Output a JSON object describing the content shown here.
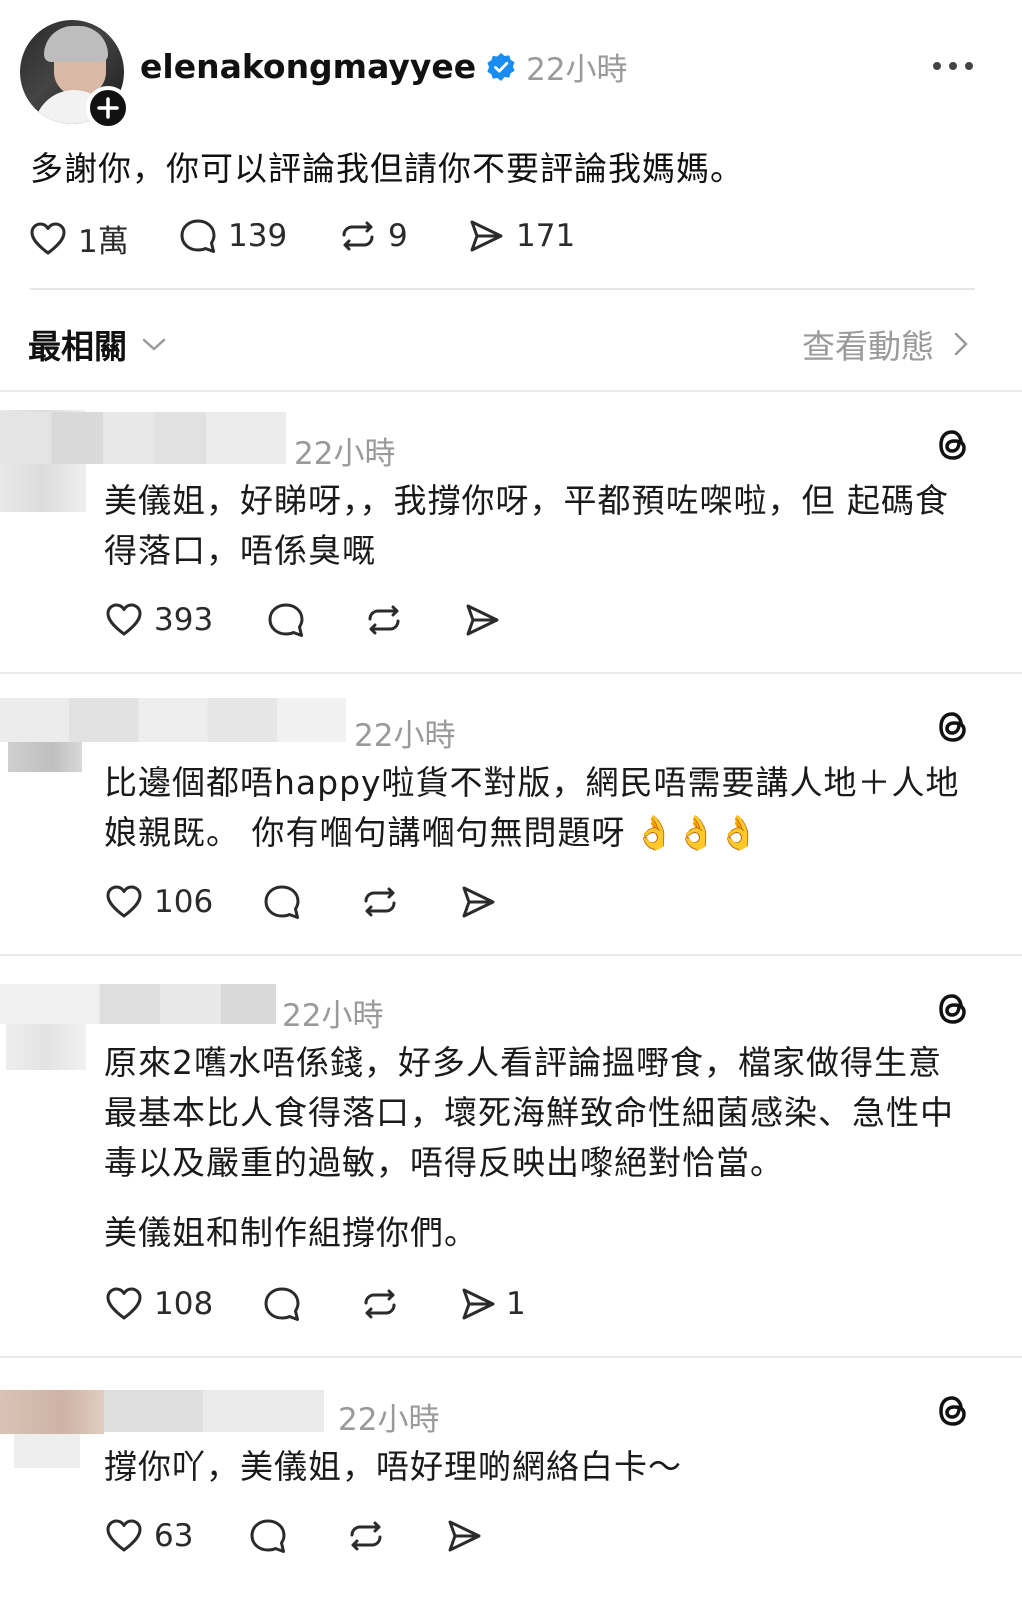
{
  "post": {
    "username": "elenakongmayyee",
    "time": "22小時",
    "text": "多謝你，你可以評論我但請你不要評論我媽媽。",
    "stats": {
      "likes": "1萬",
      "comments": "139",
      "reposts": "9",
      "shares": "171"
    }
  },
  "sort": {
    "label": "最相關",
    "view_activity": "查看動態"
  },
  "comments": [
    {
      "time": "22小時",
      "lines": [
        "美儀姐，好睇呀，，我撐你呀，平都預咗㗎啦，但 起碼食",
        "得落口，唔係臭嘅"
      ],
      "likes": "393"
    },
    {
      "time": "22小時",
      "lines": [
        "比邊個都唔happy啦貨不對版，網民唔需要講人地＋人地",
        "娘親既。 你有嗰句講嗰句無問題呀"
      ],
      "emoji": "👌👌👌",
      "likes": "106"
    },
    {
      "time": "22小時",
      "lines": [
        "原來2嚿水唔係錢，好多人看評論搵嘢食，檔家做得生意",
        "最基本比人食得落口，壞死海鮮致命性細菌感染、急性中",
        "毒以及嚴重的過敏，唔得反映出嚟絕對恰當。"
      ],
      "extra": "美儀姐和制作組撐你們。",
      "likes": "108",
      "shares": "1"
    },
    {
      "time": "22小時",
      "lines": [
        "撐你吖，美儀姐，唔好理啲網絡白卡～"
      ],
      "likes": "63"
    }
  ],
  "icons": [
    "heart-icon",
    "comment-icon",
    "repost-icon",
    "share-icon",
    "threads-icon",
    "more-icon",
    "chevron-down-icon",
    "chevron-right-icon",
    "verified-icon",
    "plus-icon"
  ]
}
